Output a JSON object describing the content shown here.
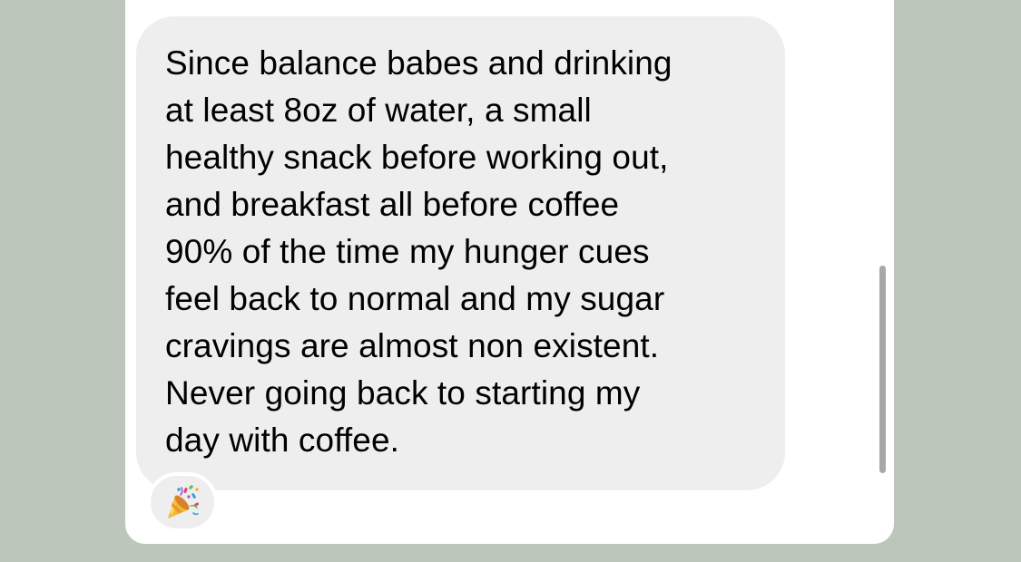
{
  "message": {
    "lines": [
      "Since balance babes and drinking",
      "at least 8oz of water, a small",
      "healthy snack before working out,",
      "and breakfast all before coffee",
      "90% of the time my hunger cues",
      "feel back to normal and my sugar",
      "cravings are almost non existent.",
      "Never going back to starting my",
      "day with coffee."
    ]
  },
  "reaction": {
    "icon": "party-popper-icon"
  },
  "colors": {
    "background": "#bcc6bb",
    "panel": "#ffffff",
    "bubble": "#eeeeee",
    "text": "#000000",
    "scrollbar": "#a8a8a8"
  }
}
